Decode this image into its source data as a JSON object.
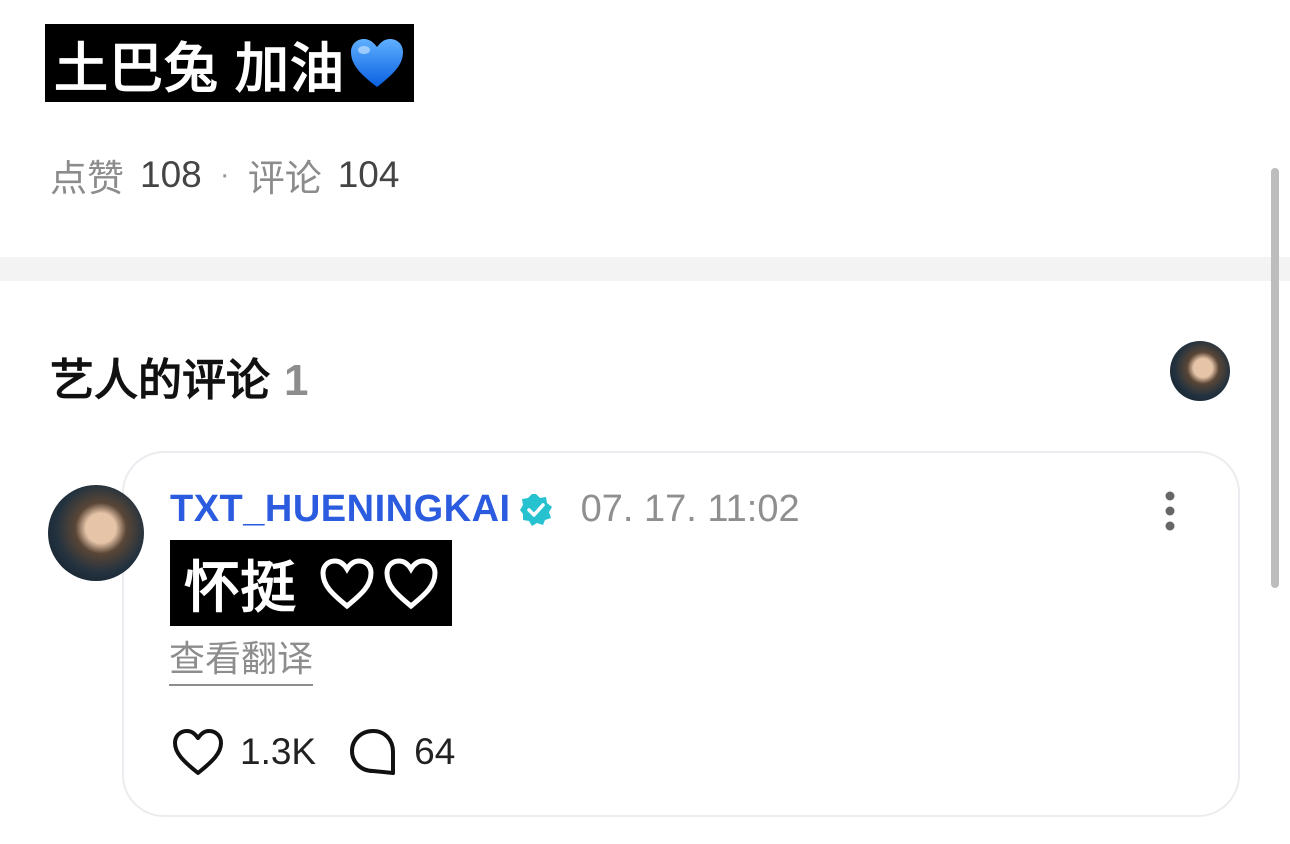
{
  "post": {
    "title": "土巴兔 加油",
    "title_heart_icon": "blue-heart-emoji",
    "likes_label": "点赞",
    "likes_count": "108",
    "separator": "·",
    "comments_label": "评论",
    "comments_count": "104"
  },
  "artist_comments": {
    "title": "艺人的评论",
    "count": "1"
  },
  "comment": {
    "author": "TXT_HUENINGKAI",
    "verified_icon": "verified-badge-icon",
    "timestamp": "07. 17. 11:02",
    "text": "怀挺",
    "translate_label": "查看翻译",
    "like_count": "1.3K",
    "reply_count": "64"
  },
  "colors": {
    "author": "#2b5bde",
    "verified": "#26c2cf",
    "muted": "#8d8d8d",
    "heart_blue": "#1e7cf2"
  }
}
